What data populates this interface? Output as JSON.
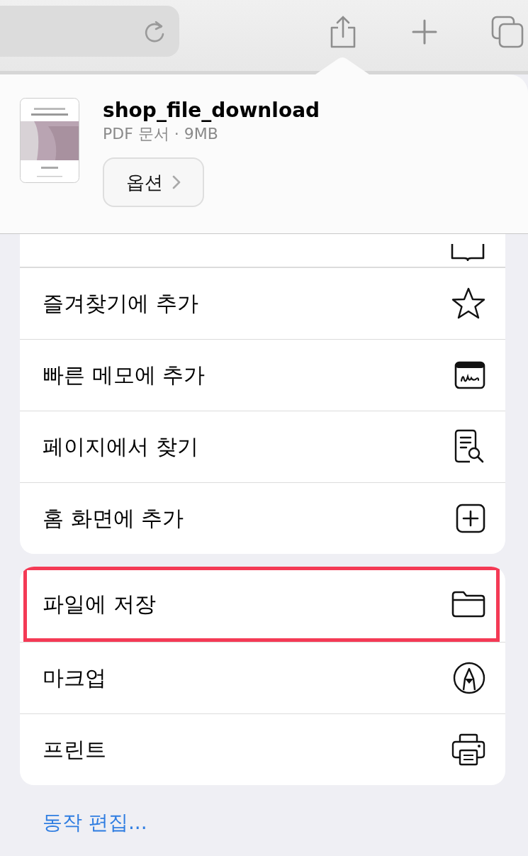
{
  "file": {
    "name": "shop_file_download",
    "meta": "PDF 문서 · 9MB",
    "options_button": "옵션"
  },
  "groups": [
    {
      "items": [
        {
          "label": "즐겨찾기에 추가",
          "highlighted": false
        },
        {
          "label": "빠른 메모에 추가",
          "highlighted": false
        },
        {
          "label": "페이지에서 찾기",
          "highlighted": false
        },
        {
          "label": "홈 화면에 추가",
          "highlighted": false
        }
      ]
    },
    {
      "items": [
        {
          "label": "파일에 저장",
          "highlighted": true
        },
        {
          "label": "마크업",
          "highlighted": false
        },
        {
          "label": "프린트",
          "highlighted": false
        }
      ]
    }
  ],
  "edit_actions_link": "동작 편집..."
}
